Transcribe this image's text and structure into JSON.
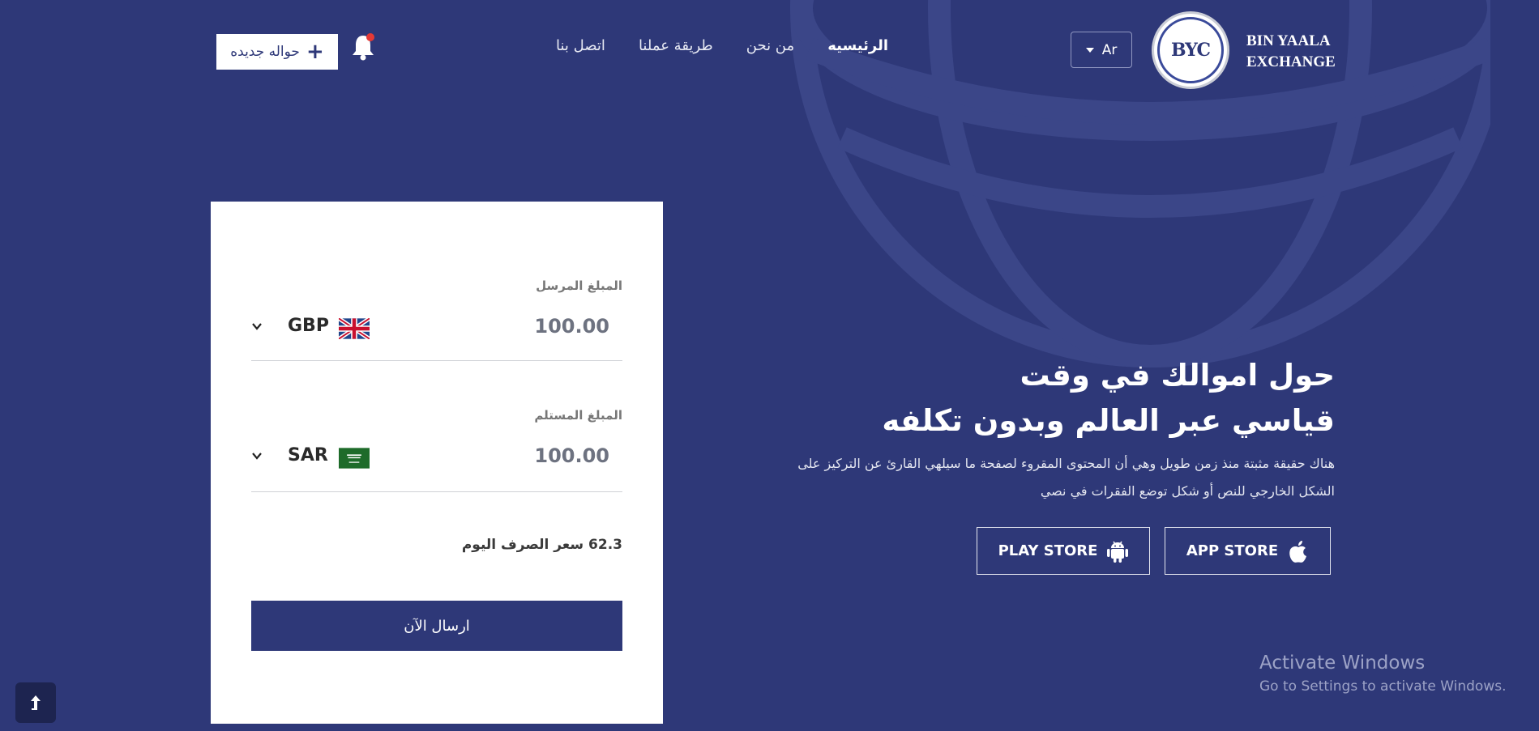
{
  "brand": {
    "logo_text": "BYC",
    "name_line1": "BIN YAALA",
    "name_line2": "EXCHANGE"
  },
  "language": {
    "selected": "Ar"
  },
  "nav": {
    "items": [
      {
        "label": "الرئيسيه",
        "active": true
      },
      {
        "label": "من نحن",
        "active": false
      },
      {
        "label": "طريقة عملنا",
        "active": false
      },
      {
        "label": "اتصل بنا",
        "active": false
      }
    ]
  },
  "header": {
    "new_transfer_label": "حواله جديده",
    "notification_icon": "bell-icon",
    "notification_dot_color": "#e53935"
  },
  "converter": {
    "sent_label": "المبلغ المرسل",
    "sent_amount": "100.00",
    "sent_currency": "GBP",
    "received_label": "المبلغ المستلم",
    "received_amount": "100.00",
    "received_currency": "SAR",
    "rate_text": "62.3 سعر الصرف اليوم",
    "send_label": "ارسال الآن"
  },
  "hero": {
    "title_line1": "حول اموالك في وقت",
    "title_line2": "قياسي عبر العالم وبدون تكلفه",
    "text_line1": "هناك حقيقة مثبتة منذ زمن طويل وهي أن المحتوى المقروء لصفحة ما سيلهي القارئ عن التركيز على",
    "text_line2": "الشكل الخارجي للنص أو شكل توضع الفقرات في نصي"
  },
  "stores": {
    "app_store_label": "APP STORE",
    "play_store_label": "PLAY STORE"
  },
  "watermark": {
    "line1": "Activate Windows",
    "line2": "Go to Settings to activate Windows."
  },
  "colors": {
    "primary": "#2e3878",
    "card": "#ffffff",
    "scroll_button": "#1d2450"
  }
}
